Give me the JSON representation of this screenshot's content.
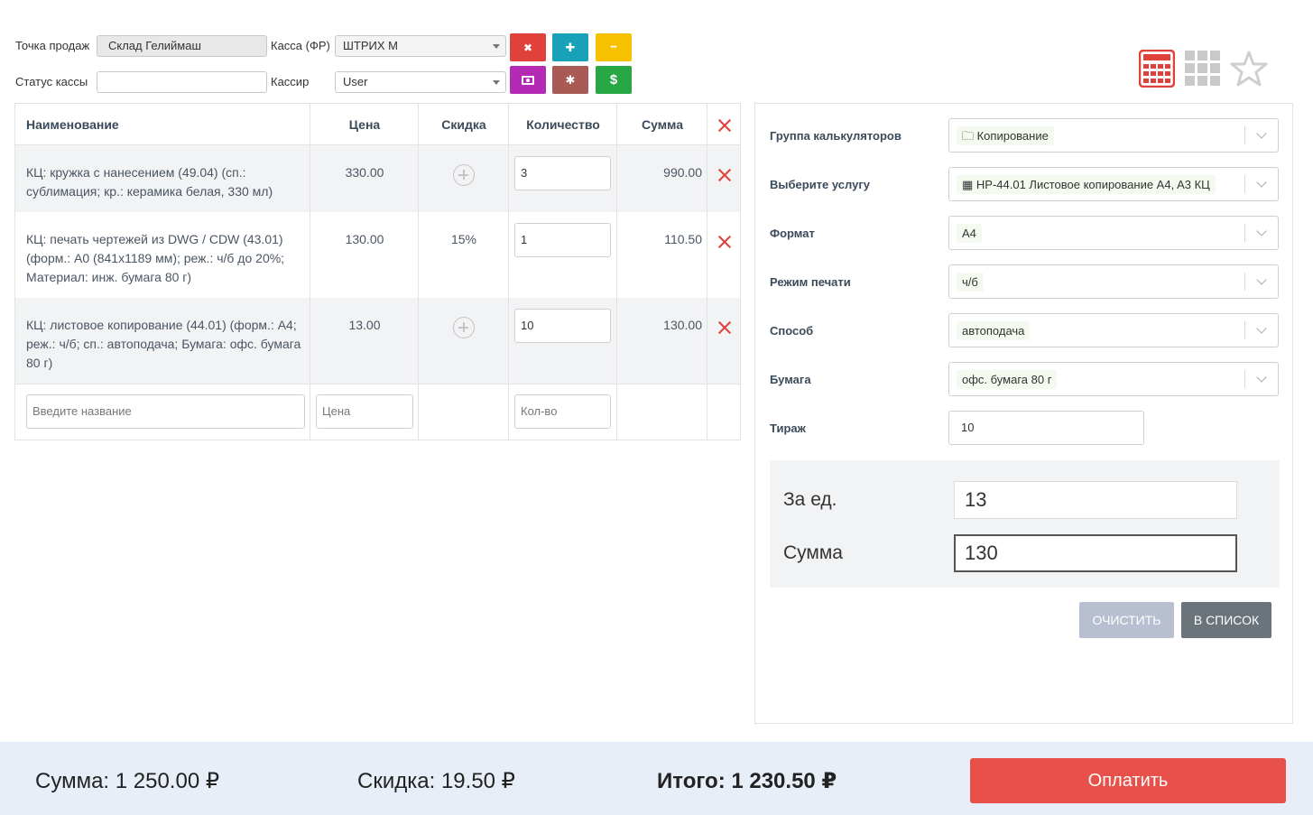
{
  "toolbar": {
    "point_label": "Точка продаж",
    "point_value": "Склад Гелиймаш",
    "kassa_label": "Касса (ФР)",
    "kassa_value": "ШТРИХ М",
    "status_label": "Статус кассы",
    "status_value": "",
    "cashier_label": "Кассир",
    "cashier_value": "User",
    "buttons": [
      {
        "name": "close-shift-button",
        "glyph": "✖",
        "color": "#e0413a"
      },
      {
        "name": "deposit-button",
        "glyph": "✚",
        "color": "#17a2b8"
      },
      {
        "name": "withdraw-button",
        "glyph": "━",
        "color": "#f7c100"
      },
      {
        "name": "cash-button",
        "glyph": "▣",
        "color": "#b52ab5"
      },
      {
        "name": "settings-button",
        "glyph": "✱",
        "color": "#a85a55"
      },
      {
        "name": "dollar-button",
        "glyph": "$",
        "color": "#28a745"
      }
    ]
  },
  "view_icons": [
    "calculator-icon",
    "grid-icon",
    "star-icon"
  ],
  "table": {
    "headers": {
      "name": "Наименование",
      "price": "Цена",
      "discount": "Скидка",
      "qty": "Количество",
      "sum": "Сумма"
    },
    "rows": [
      {
        "name": "КЦ: кружка с нанесением (49.04) (сп.: сублимация; кр.: керамика белая, 330 мл)",
        "price": "330.00",
        "discount": "",
        "qty": "3",
        "sum": "990.00"
      },
      {
        "name": "КЦ: печать чертежей из DWG / CDW (43.01) (форм.: A0 (841x1189 мм); реж.: ч/б до 20%; Материал: инж. бумага 80 г)",
        "price": "130.00",
        "discount": "15%",
        "qty": "1",
        "sum": "110.50"
      },
      {
        "name": "КЦ: листовое копирование (44.01) (форм.: A4; реж.: ч/б; сп.: автоподача; Бумага: офс. бумага 80 г)",
        "price": "13.00",
        "discount": "",
        "qty": "10",
        "sum": "130.00"
      }
    ],
    "new_row": {
      "name_placeholder": "Введите название",
      "price_placeholder": "Цена",
      "qty_placeholder": "Кол-во"
    }
  },
  "calculator": {
    "fields": [
      {
        "label": "Группа калькуляторов",
        "value": "🗀 Копирование"
      },
      {
        "label": "Выберите услугу",
        "value": "▦ НР-44.01 Листовое копирование A4, A3 КЦ"
      },
      {
        "label": "Формат",
        "value": "A4"
      },
      {
        "label": "Режим печати",
        "value": "ч/б"
      },
      {
        "label": "Способ",
        "value": "автоподача"
      },
      {
        "label": "Бумага",
        "value": "офс. бумага 80 г"
      }
    ],
    "tirage_label": "Тираж",
    "tirage_value": "10",
    "per_unit_label": "За ед.",
    "per_unit_value": "13",
    "sum_label": "Сумма",
    "sum_value": "130",
    "clear_label": "ОЧИСТИТЬ",
    "to_list_label": "В СПИСОК"
  },
  "footer": {
    "sum_text": "Сумма: 1 250.00 ₽",
    "discount_text": "Скидка: 19.50 ₽",
    "total_text": "Итого: 1 230.50 ₽",
    "pay_label": "Оплатить"
  }
}
